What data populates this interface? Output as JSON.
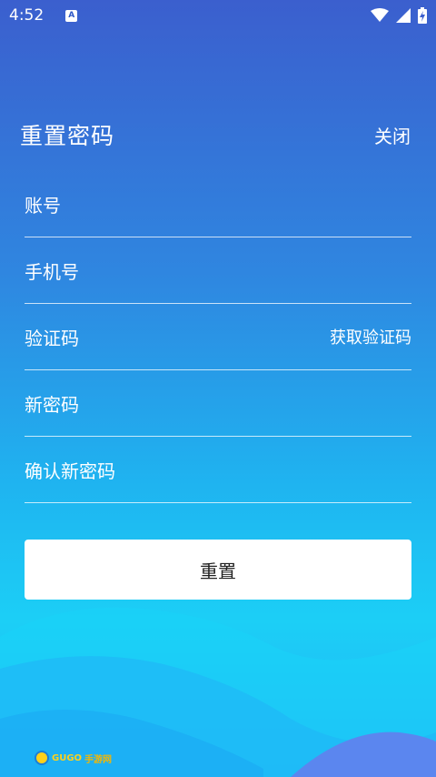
{
  "status_bar": {
    "time": "4:52",
    "notification_icon": "text-a-icon",
    "wifi_icon": "wifi-icon",
    "signal_icon": "cell-signal-icon",
    "battery_icon": "battery-charging-icon"
  },
  "header": {
    "title": "重置密码",
    "close_label": "关闭"
  },
  "form": {
    "account_label": "账号",
    "phone_label": "手机号",
    "code_label": "验证码",
    "get_code_label": "获取验证码",
    "new_password_label": "新密码",
    "confirm_password_label": "确认新密码",
    "submit_label": "重置"
  },
  "watermark": {
    "text_part1": "GUGO",
    "text_part2": "手游网"
  },
  "colors": {
    "gradient_top": "#3b5fce",
    "gradient_bottom": "#1ccff6",
    "button_bg": "#ffffff",
    "button_text": "#222222"
  }
}
